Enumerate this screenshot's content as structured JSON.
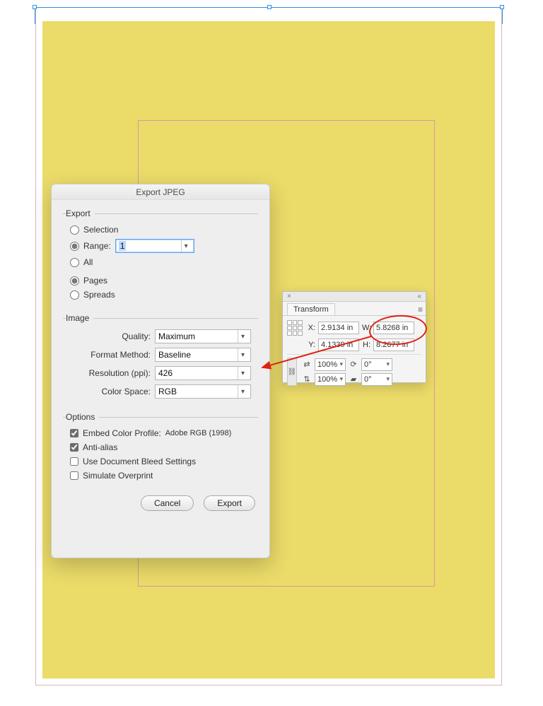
{
  "dialog": {
    "title": "Export JPEG",
    "export_legend": "Export",
    "selection_label": "Selection",
    "range_label": "Range:",
    "range_value": "1",
    "all_label": "All",
    "pages_label": "Pages",
    "spreads_label": "Spreads",
    "image_legend": "Image",
    "quality_label": "Quality:",
    "quality_value": "Maximum",
    "format_label": "Format Method:",
    "format_value": "Baseline",
    "resolution_label": "Resolution (ppi):",
    "resolution_value": "426",
    "colorspace_label": "Color Space:",
    "colorspace_value": "RGB",
    "options_legend": "Options",
    "embed_label": "Embed Color Profile:",
    "embed_profile": "Adobe RGB (1998)",
    "antialias_label": "Anti-alias",
    "bleed_label": "Use Document Bleed Settings",
    "overprint_label": "Simulate Overprint",
    "cancel_label": "Cancel",
    "export_label": "Export"
  },
  "transform": {
    "tab_label": "Transform",
    "x_label": "X:",
    "x_value": "2.9134 in",
    "y_label": "Y:",
    "y_value": "4.1339 in",
    "w_label": "W:",
    "w_value": "5.8268 in",
    "h_label": "H:",
    "h_value": "8.2677 in",
    "scale_x": "100%",
    "scale_y": "100%",
    "rotate": "0°",
    "shear": "0°"
  }
}
